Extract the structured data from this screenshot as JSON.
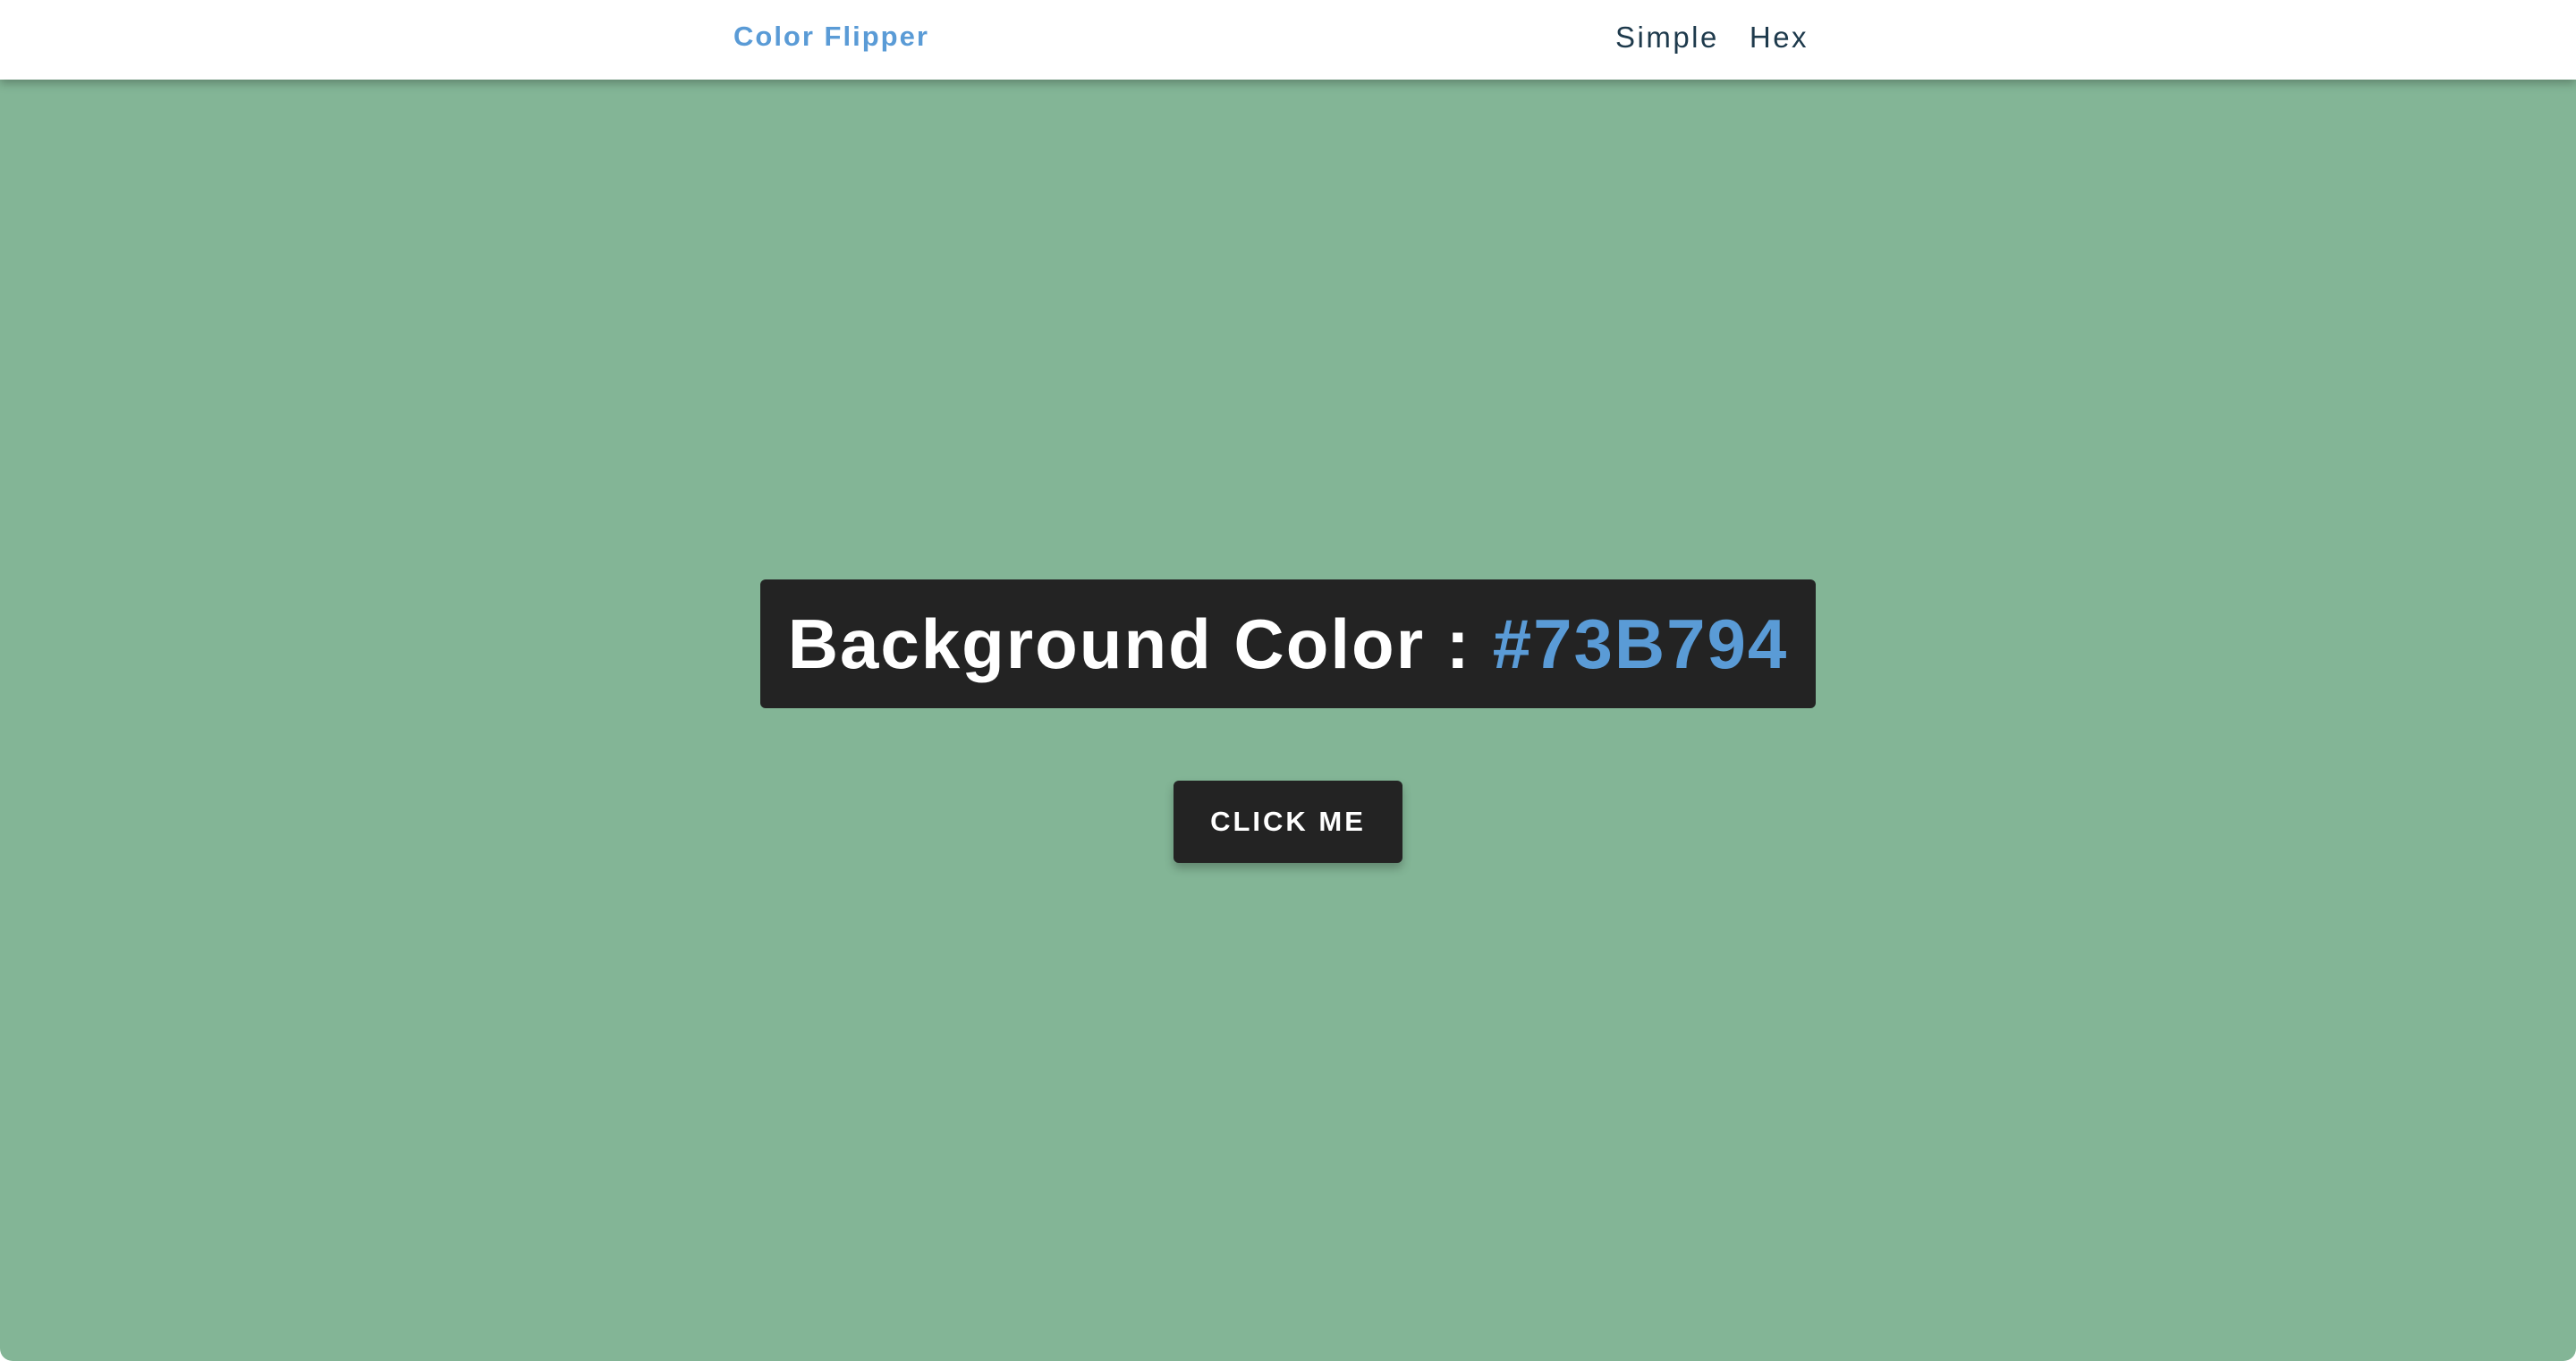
{
  "navbar": {
    "brand": "Color Flipper",
    "links": [
      {
        "label": "Simple"
      },
      {
        "label": "Hex"
      }
    ]
  },
  "main": {
    "label": "Background Color :",
    "color_value": "#73B794",
    "button_label": "CLICK ME"
  },
  "colors": {
    "page_background": "#83b596",
    "accent": "#5a9bd6",
    "dark": "#232323",
    "nav_text": "#1e3a4c"
  }
}
